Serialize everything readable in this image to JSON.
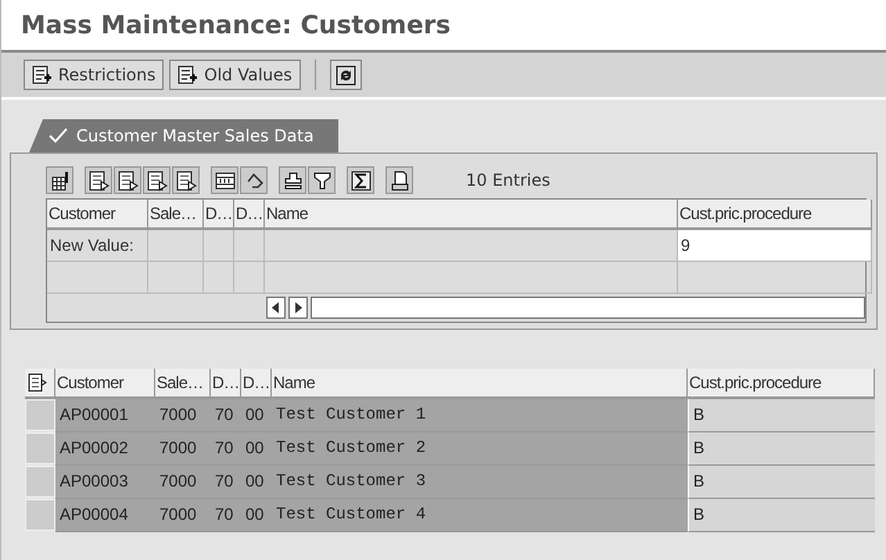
{
  "window": {
    "title": "Mass Maintenance: Customers"
  },
  "toolbar": {
    "buttons": [
      {
        "label": "Restrictions"
      },
      {
        "label": "Old Values"
      }
    ]
  },
  "tabs": [
    {
      "label": "Customer Master Sales Data",
      "selected": true
    }
  ],
  "upper_grid": {
    "entries": "10 Entries",
    "columns": [
      "Customer",
      "Sale…",
      "D…",
      "D…",
      "Name",
      "Cust.pric.procedure"
    ],
    "rows": [
      [
        "New Value:",
        "",
        "",
        "",
        "",
        "9"
      ],
      [
        "",
        "",
        "",
        "",
        "",
        ""
      ]
    ]
  },
  "lower_grid": {
    "columns": [
      "Customer",
      "Sale…",
      "D…",
      "D…",
      "Name",
      "Cust.pric.procedure"
    ],
    "rows": [
      {
        "selected": false,
        "cells": [
          "AP00001",
          "7000",
          "70",
          "00",
          "Test Customer 1",
          "B"
        ]
      },
      {
        "selected": false,
        "cells": [
          "AP00002",
          "7000",
          "70",
          "00",
          "Test Customer 2",
          "B"
        ]
      },
      {
        "selected": false,
        "cells": [
          "AP00003",
          "7000",
          "70",
          "00",
          "Test Customer 3",
          "B"
        ]
      },
      {
        "selected": false,
        "cells": [
          "AP00004",
          "7000",
          "70",
          "00",
          "Test Customer 4",
          "B"
        ]
      }
    ]
  }
}
